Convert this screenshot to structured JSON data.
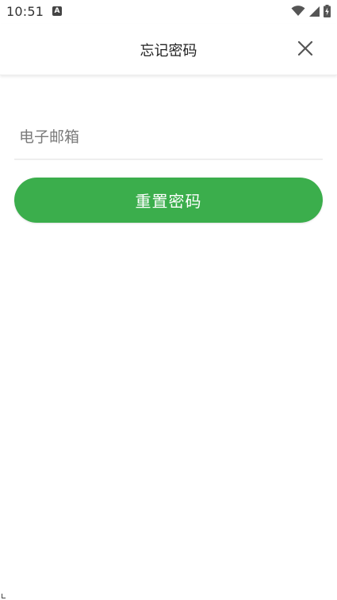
{
  "status_bar": {
    "time": "10:51",
    "notification_icon_letter": "A",
    "icons": [
      "wifi-icon",
      "signal-icon",
      "battery-icon"
    ]
  },
  "header": {
    "title": "忘记密码",
    "close_icon": "close-icon"
  },
  "form": {
    "email": {
      "placeholder": "电子邮箱",
      "value": ""
    },
    "submit_label": "重置密码"
  },
  "colors": {
    "accent": "#3bae4c",
    "background": "#ffffff",
    "divider": "#eeeeee"
  }
}
